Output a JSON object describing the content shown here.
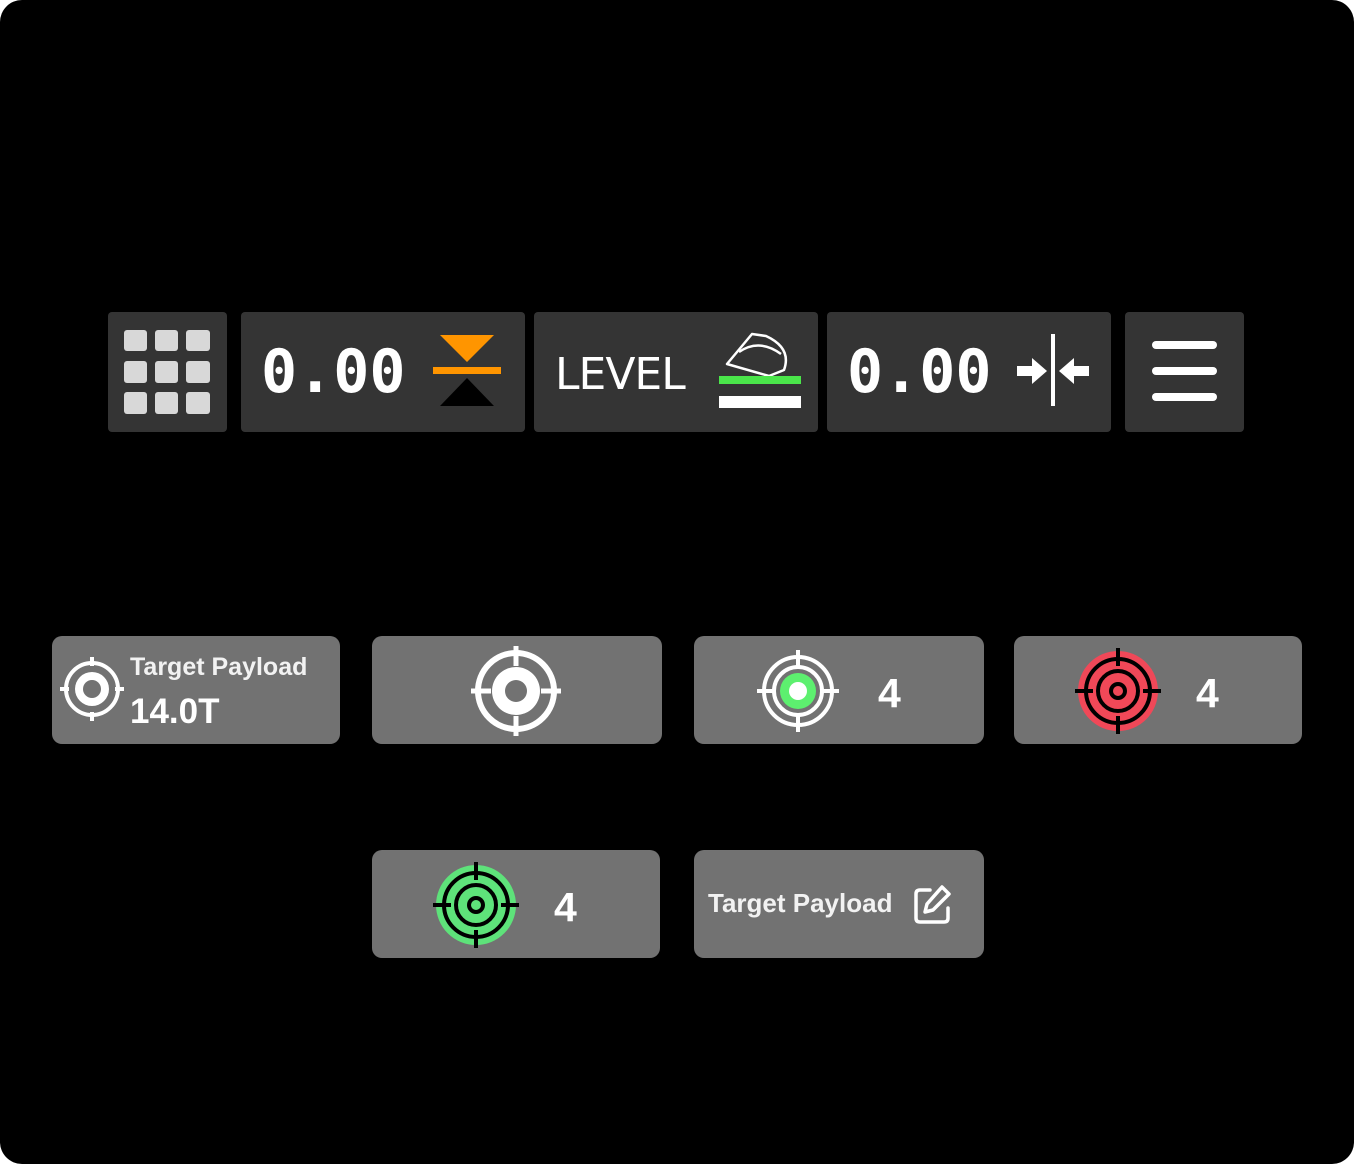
{
  "toolbar": {
    "apps_icon": "grid-icon",
    "height_value": "0.00",
    "height_icon": "height-alignment-icon",
    "level_label": "LEVEL",
    "level_icon": "bucket-level-icon",
    "width_value": "0.00",
    "width_icon": "width-alignment-icon",
    "menu_icon": "hamburger-menu-icon"
  },
  "payload_cards": {
    "summary": {
      "label": "Target Payload",
      "value": "14.0T",
      "icon": "target-icon"
    },
    "target_only": {
      "icon": "target-icon"
    },
    "target_light_green": {
      "count": "4",
      "icon": "target-icon",
      "color": "#5df06f"
    },
    "target_red": {
      "count": "4",
      "icon": "target-icon",
      "color": "#f04858"
    },
    "target_green": {
      "count": "4",
      "icon": "target-icon",
      "color": "#5ee27a"
    },
    "edit": {
      "label": "Target Payload",
      "icon": "edit-icon"
    }
  },
  "colors": {
    "background": "#000000",
    "tile": "#343434",
    "card": "#727272",
    "orange": "#ff9500",
    "green": "#4ae54a",
    "red": "#f04858"
  }
}
